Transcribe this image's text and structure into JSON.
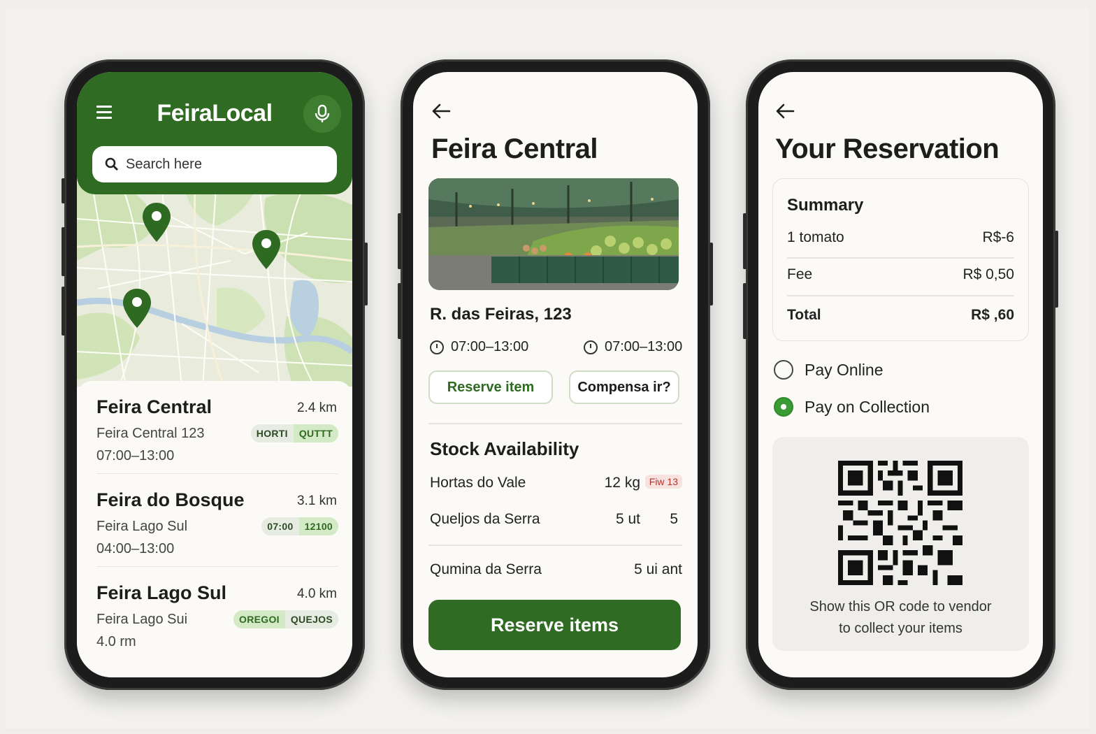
{
  "screens": {
    "home": {
      "app_title": "FeiraLocal",
      "menu_icon": "menu-icon",
      "mic_icon": "microphone-icon",
      "search": {
        "placeholder": "Search here",
        "icon": "search-icon"
      },
      "map_pins": [
        "map-pin-icon",
        "map-pin-icon",
        "map-pin-icon"
      ],
      "fairs": [
        {
          "name": "Feira Central",
          "distance": "2.4 km",
          "address": "Feira Central 123",
          "hours": "07:00–13:00",
          "tags": [
            "HORTI",
            "QUTTT"
          ]
        },
        {
          "name": "Feira do Bosque",
          "distance": "3.1 km",
          "address": "Feira Lago Sul",
          "hours": "04:00–13:00",
          "tags": [
            "07:00",
            "12100"
          ]
        },
        {
          "name": "Feira Lago Sul",
          "distance": "4.0 km",
          "address": "Feira Lago Sui",
          "hours": "4.0 rm",
          "tags": [
            "OREGOI",
            "QUEJOS"
          ]
        }
      ]
    },
    "market": {
      "back_icon": "back-arrow-icon",
      "title": "Feira Central",
      "address": "R. das Feiras, 123",
      "hours_left": "07:00–13:00",
      "hours_right": "07:00–13:00",
      "reserve_item_label": "Reserve item",
      "compensate_label": "Compensa ir?",
      "stock_title": "Stock Availability",
      "stock": [
        {
          "vendor": "Hortas do Vale",
          "qty": "12 kg",
          "extra": "Fiw 13"
        },
        {
          "vendor": "Queljos da Serra",
          "qty": "5 ut",
          "extra": "5"
        },
        {
          "vendor": "Qumina da Serra",
          "qty": "",
          "extra": "5 ui ant"
        }
      ],
      "reserve_items_label": "Reserve items"
    },
    "reservation": {
      "back_icon": "back-arrow-icon",
      "title": "Your Reservation",
      "summary_title": "Summary",
      "rows": [
        {
          "label": "1 tomato",
          "value": "R$-6"
        },
        {
          "label": "Fee",
          "value": "R$ 0,50"
        },
        {
          "label": "Total",
          "value": "R$ ,60"
        }
      ],
      "pay_online": "Pay Online",
      "pay_collection": "Pay on Collection",
      "selected_payment": "Pay on Collection",
      "qr_caption_line1": "Show this OR code to vendor",
      "qr_caption_line2": "to collect your items"
    }
  },
  "colors": {
    "primary": "#2f6b22",
    "accent": "#3a9a34",
    "background": "#f3f2ef"
  }
}
